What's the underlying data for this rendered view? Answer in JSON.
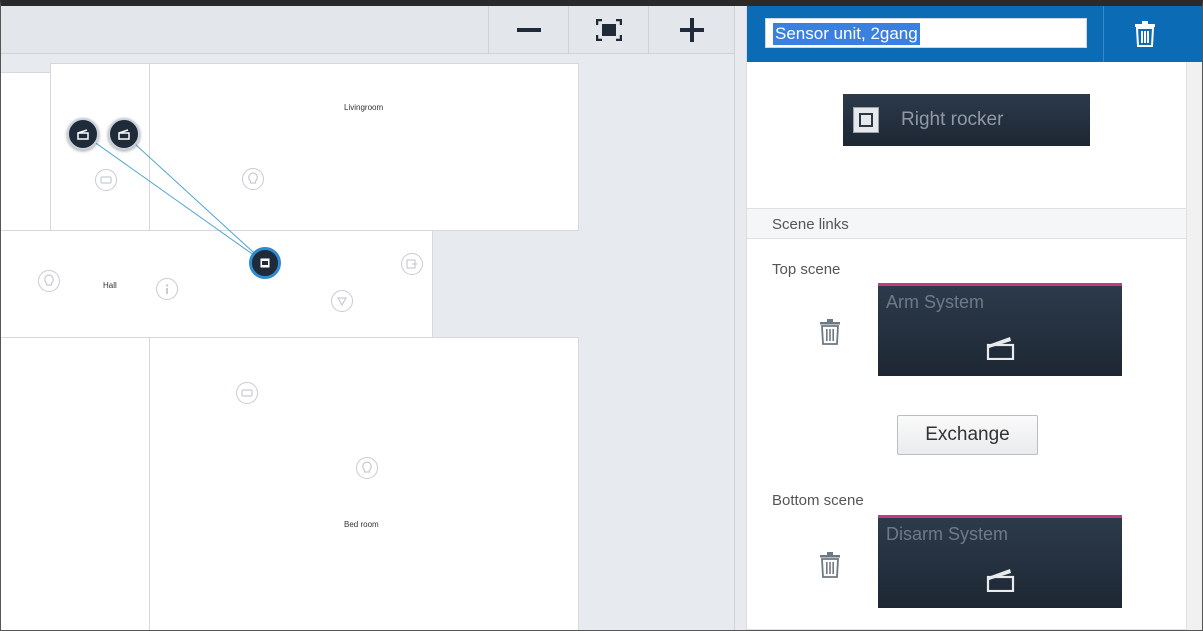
{
  "toolbar": {
    "zoom_out_icon": "minus-icon",
    "fit_icon": "fit-to-screen-icon",
    "zoom_in_icon": "plus-icon"
  },
  "rooms": {
    "livingroom": "Livingroom",
    "hall": "Hall",
    "bedroom": "Bed room"
  },
  "device": {
    "name": "Sensor unit, 2gang",
    "delete_icon": "trash-icon",
    "rocker_label": "Right rocker"
  },
  "scene_links": {
    "section_title": "Scene links",
    "top_label": "Top scene",
    "top_scene_name": "Arm System",
    "exchange_label": "Exchange",
    "bottom_label": "Bottom scene",
    "bottom_scene_name": "Disarm System"
  },
  "colors": {
    "header_blue": "#0b6cb5",
    "tile_dark": "#1d2733",
    "scene_accent": "#c2398a",
    "link_line": "#4aa3d6"
  }
}
